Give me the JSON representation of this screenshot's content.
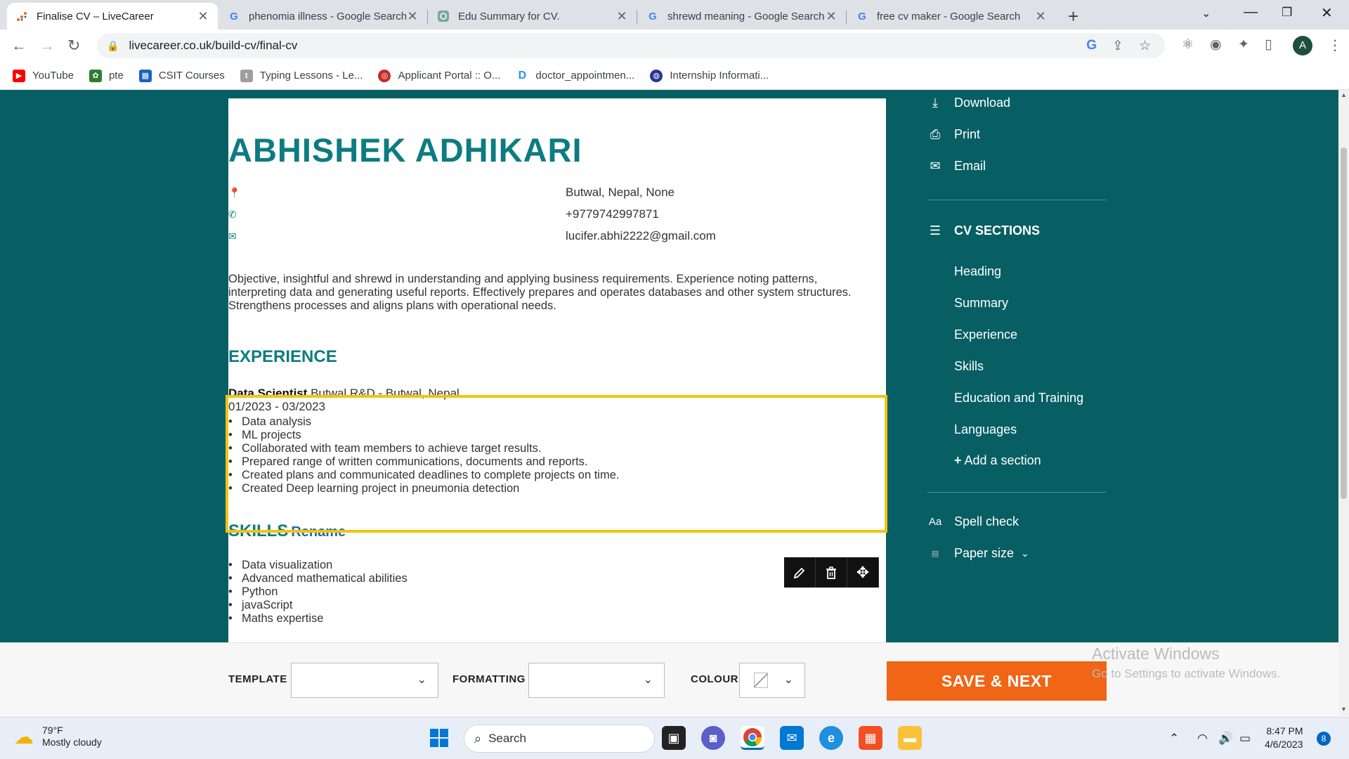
{
  "browser": {
    "tabs": [
      {
        "title": "Finalise CV – LiveCareer",
        "icon": "livecareer-icon",
        "active": true
      },
      {
        "title": "phenomia illness - Google Search",
        "icon": "google-icon"
      },
      {
        "title": "Edu Summary for CV.",
        "icon": "chatgpt-icon"
      },
      {
        "title": "shrewd meaning - Google Search",
        "icon": "google-icon"
      },
      {
        "title": "free cv maker - Google Search",
        "icon": "google-icon"
      }
    ],
    "url": "livecareer.co.uk/build-cv/final-cv",
    "profile_initial": "A",
    "bookmarks": [
      {
        "label": "YouTube",
        "icon": "youtube-icon",
        "color": "#ff0000"
      },
      {
        "label": "pte",
        "icon": "pte-icon",
        "color": "#2e7d32"
      },
      {
        "label": "CSIT Courses",
        "icon": "courses-icon",
        "color": "#1565c0"
      },
      {
        "label": "Typing Lessons - Le...",
        "icon": "typing-icon",
        "color": "#9e9e9e"
      },
      {
        "label": "Applicant Portal :: O...",
        "icon": "portal-icon",
        "color": "#c62828"
      },
      {
        "label": "doctor_appointmen...",
        "icon": "doctor-icon",
        "color": "#2196f3"
      },
      {
        "label": "Internship Informati...",
        "icon": "internship-icon",
        "color": "#283593"
      }
    ]
  },
  "cv": {
    "name": "ABHISHEK ADHIKARI",
    "address": "Butwal, Nepal, None",
    "phone": "+9779742997871",
    "email": "lucifer.abhi2222@gmail.com",
    "summary": "Objective, insightful and shrewd in understanding and applying business requirements. Experience noting patterns, interpreting data and generating useful reports. Effectively prepares and operates databases and other system structures. Strengthens processes and aligns plans with operational needs.",
    "experience_title": "EXPERIENCE",
    "job_title": "Data Scientist",
    "job_company": "Butwal R&D - Butwal, Nepal",
    "job_dates": "01/2023 - 03/2023",
    "job_bullets": [
      "Data analysis",
      "ML projects",
      "Collaborated with team members to achieve target results.",
      "Prepared range of written communications, documents and reports.",
      "Created plans and communicated deadlines to complete projects on time.",
      "Created Deep learning project in pneumonia detection"
    ],
    "skills_title": "SKILLS",
    "rename_label": "Rename",
    "skills": [
      "Data visualization",
      "Advanced mathematical abilities",
      "Python",
      "javaScript",
      "Maths expertise"
    ]
  },
  "sidebar": {
    "actions": [
      {
        "label": "Download",
        "icon": "download-icon"
      },
      {
        "label": "Print",
        "icon": "print-icon"
      },
      {
        "label": "Email",
        "icon": "email-icon"
      }
    ],
    "sections_heading": "CV SECTIONS",
    "sections": [
      "Heading",
      "Summary",
      "Experience",
      "Skills",
      "Education and Training",
      "Languages"
    ],
    "add_section": "Add a section",
    "spell_check": "Spell check",
    "paper_size": "Paper size"
  },
  "bottombar": {
    "template_label": "TEMPLATE",
    "formatting_label": "FORMATTING",
    "colour_label": "COLOUR",
    "save_next": "SAVE & NEXT",
    "watermark_title": "Activate Windows",
    "watermark_sub": "Go to Settings to activate Windows."
  },
  "taskbar": {
    "temperature": "79°F",
    "weather": "Mostly cloudy",
    "search_placeholder": "Search",
    "time": "8:47 PM",
    "date": "4/6/2023",
    "notifications": "8"
  },
  "colors": {
    "page_bg": "#075f63",
    "accent_teal": "#0c7c82",
    "save_button": "#f06516",
    "selection_border": "#f2c40f"
  }
}
